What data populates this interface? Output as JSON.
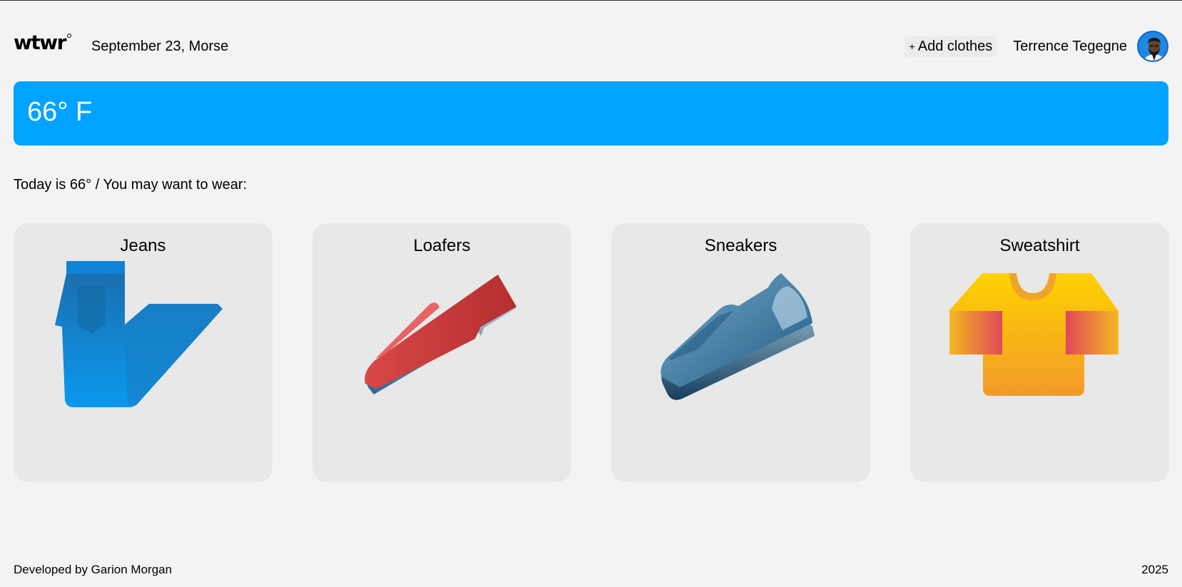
{
  "header": {
    "logo": "wtwr",
    "date_location": "September 23, Morse",
    "add_clothes_label": "Add clothes",
    "add_plus": "+",
    "username": "Terrence Tegegne"
  },
  "weather": {
    "temperature_display": "66° F"
  },
  "recommendation_text": "Today is 66° / You may want to wear:",
  "items": [
    {
      "name": "Jeans",
      "icon": "jeans-icon",
      "color": "#0a8fe0"
    },
    {
      "name": "Loafers",
      "icon": "loafers-icon",
      "color": "#c23131"
    },
    {
      "name": "Sneakers",
      "icon": "sneakers-icon",
      "color": "#2e6c98"
    },
    {
      "name": "Sweatshirt",
      "icon": "sweatshirt-icon",
      "color": "#f5b020"
    }
  ],
  "footer": {
    "developer": "Developed by Garion Morgan",
    "year": "2025"
  },
  "colors": {
    "accent": "#00a3ff",
    "background": "#f3f3f3",
    "card": "#e8e8e8"
  }
}
